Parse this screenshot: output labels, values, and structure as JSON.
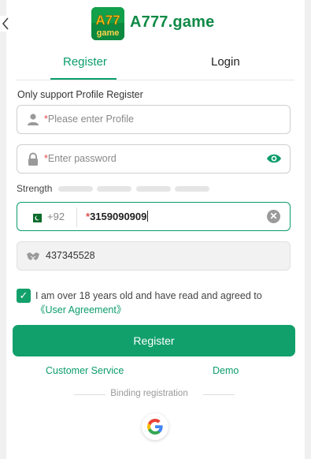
{
  "header": {
    "brand": "A777.game",
    "logo_line1": "A77",
    "logo_line2": "game"
  },
  "tabs": [
    {
      "label": "Register",
      "active": true
    },
    {
      "label": "Login",
      "active": false
    }
  ],
  "form": {
    "hint": "Only support Profile Register",
    "profile_placeholder": "Please enter Profile",
    "password_placeholder": "Enter password",
    "required_mark": "*",
    "strength_label": "Strength",
    "phone": {
      "country_code": "+92",
      "value": "3159090909"
    },
    "invite_code": "437345528",
    "agreement_text": "I am over 18 years old and have read and agreed to ",
    "agreement_link": "《User Agreement》",
    "agreement_checked": true
  },
  "actions": {
    "register_label": "Register",
    "customer_service": "Customer Service",
    "demo": "Demo",
    "binding_label": "Binding registration"
  },
  "colors": {
    "primary": "#11a06b",
    "brand_text": "#108a47"
  }
}
